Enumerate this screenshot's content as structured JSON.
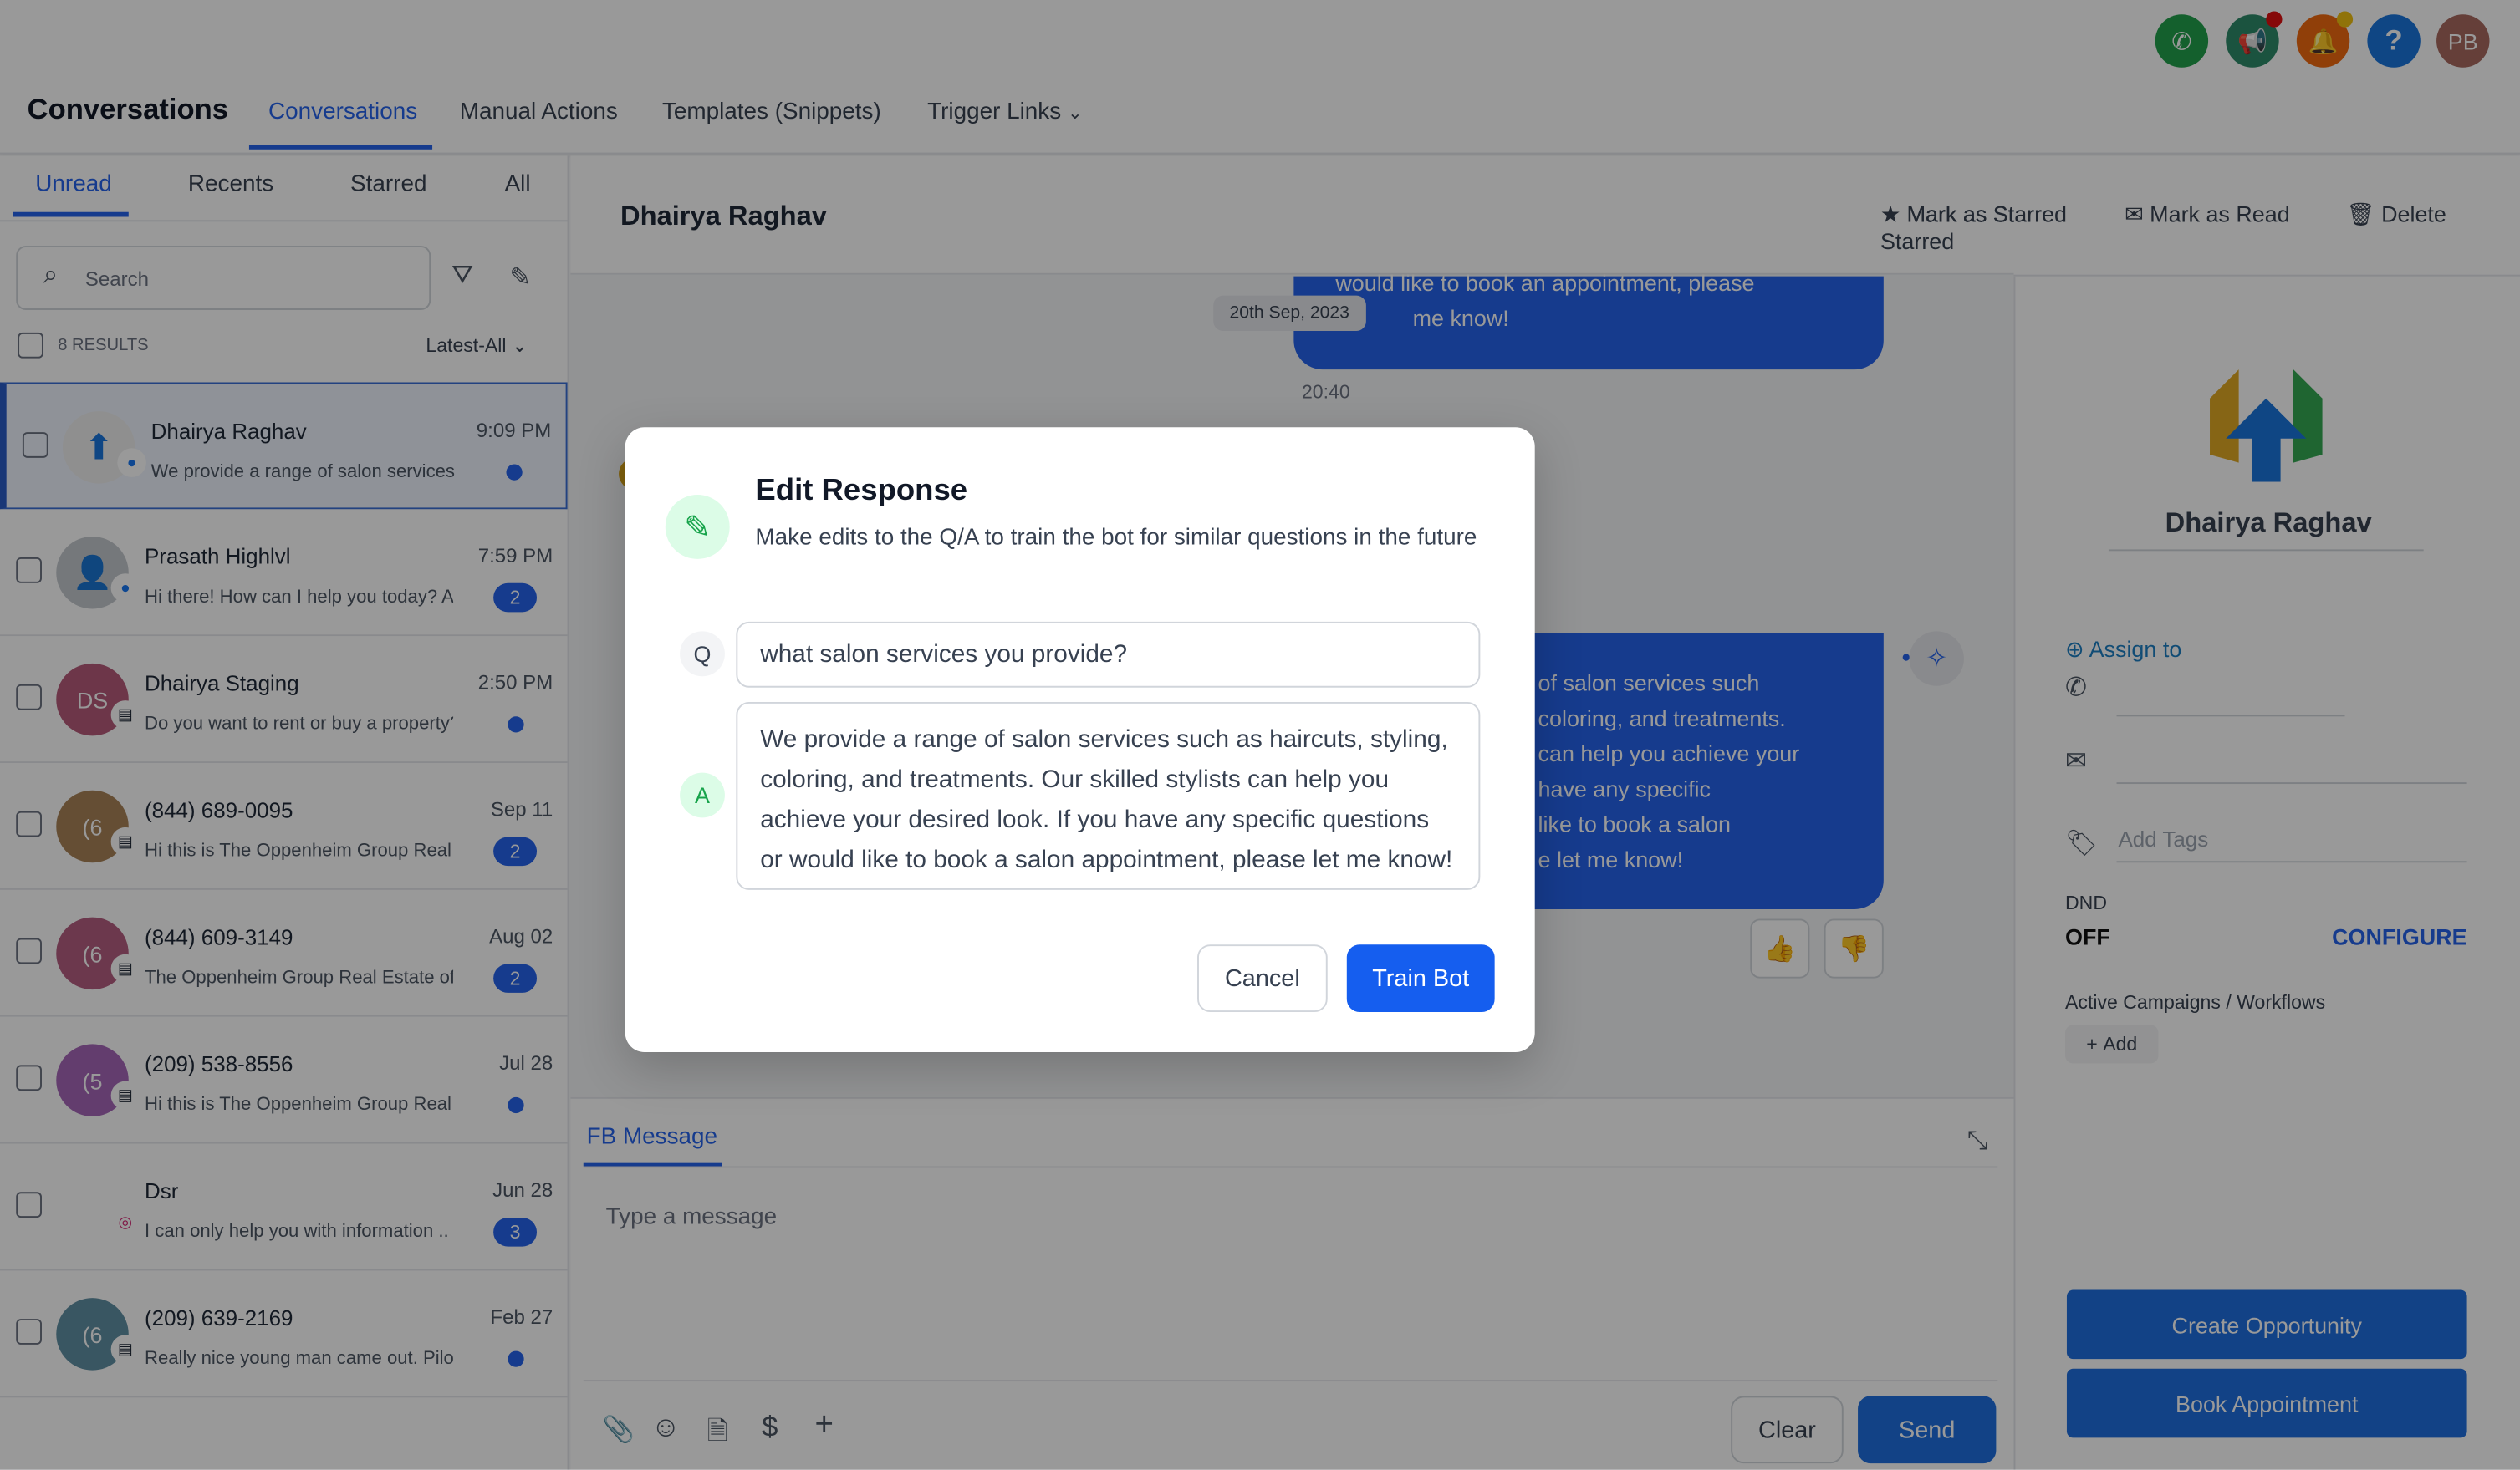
{
  "header": {
    "app_title": "Conversations",
    "nav_tabs": [
      {
        "label": "Conversations",
        "active": true
      },
      {
        "label": "Manual Actions"
      },
      {
        "label": "Templates (Snippets)"
      },
      {
        "label": "Trigger Links"
      }
    ],
    "icons": [
      {
        "name": "phone-icon",
        "color": "#22a04b"
      },
      {
        "name": "megaphone-icon",
        "color": "#2e8a6a"
      },
      {
        "name": "bell-icon",
        "color": "#f06a10"
      },
      {
        "name": "help-icon",
        "color": "#1a76dd"
      },
      {
        "name": "avatar",
        "color": "#a86a60"
      }
    ],
    "user_initials": "PB"
  },
  "sidebar": {
    "tabs": [
      "Unread",
      "Recents",
      "Starred",
      "All"
    ],
    "active_tab": "Unread",
    "search_placeholder": "Search",
    "results": "8 RESULTS",
    "sort": "Latest-All",
    "items": [
      {
        "name": "Dhairya Raghav",
        "time": "9:09 PM",
        "preview": "We provide a range of salon services",
        "unread": null,
        "channel": "messenger",
        "avatar": "logo",
        "selected": true
      },
      {
        "name": "Prasath Highlvl",
        "time": "7:59 PM",
        "preview": "Hi there! How can I help you today? A.",
        "unread": "2",
        "channel": "messenger",
        "avatar": "person"
      },
      {
        "name": "Dhairya Staging",
        "time": "2:50 PM",
        "preview": "Do you want to rent or buy a property?",
        "unread": null,
        "channel": "sms",
        "avatar": "DS",
        "color": "#b65b7a"
      },
      {
        "name": "(844) 689-0095",
        "time": "Sep 11",
        "preview": "Hi this is The Oppenheim Group Real E",
        "unread": "2",
        "channel": "sms",
        "avatar": "(6",
        "color": "#a88257"
      },
      {
        "name": "(844) 609-3149",
        "time": "Aug 02",
        "preview": "The Oppenheim Group Real Estate off",
        "unread": "2",
        "channel": "sms",
        "avatar": "(6",
        "color": "#b45e80"
      },
      {
        "name": "(209) 538-8556",
        "time": "Jul 28",
        "preview": "Hi this is The Oppenheim Group Real E",
        "unread": null,
        "channel": "sms",
        "avatar": "(5",
        "color": "#a566b8"
      },
      {
        "name": "Dsr",
        "time": "Jun 28",
        "preview": "I can only help you with information ..",
        "unread": "3",
        "channel": "instagram",
        "avatar": "image"
      },
      {
        "name": "(209) 639-2169",
        "time": "Feb 27",
        "preview": "Really nice young man came out. Pilot",
        "unread": null,
        "channel": "sms",
        "avatar": "(6",
        "color": "#5f8fa3"
      }
    ]
  },
  "conversation": {
    "contact_name": "Dhairya Raghav",
    "actions": [
      "Mark as Starred",
      "Mark as Read",
      "Delete"
    ],
    "date_chip": "20th Sep, 2023",
    "msg1_lines": [
      "would like to book an appointment, please",
      "me know!"
    ],
    "msg1_time": "20:40",
    "msg2_lines": [
      "of salon services such",
      "coloring, and treatments.",
      "can help you achieve your",
      "have any specific",
      "like to book a salon",
      "e let me know!"
    ],
    "composer": {
      "tab": "FB Message",
      "placeholder": "Type a message",
      "clear": "Clear",
      "send": "Send"
    }
  },
  "contact_panel": {
    "name": "Dhairya Raghav",
    "assign": "Assign to",
    "tags_placeholder": "Add Tags",
    "dnd_label": "DND",
    "dnd_value": "OFF",
    "configure": "CONFIGURE",
    "campaigns_label": "Active Campaigns / Workflows",
    "add": "Add",
    "create_opportunity": "Create Opportunity",
    "book_appointment": "Book Appointment"
  },
  "modal": {
    "title": "Edit Response",
    "subtitle": "Make edits to the Q/A to train the bot for similar questions in the future",
    "q_label": "Q",
    "a_label": "A",
    "question": "what salon services you provide?",
    "answer": "We provide a range of salon services such as haircuts, styling, coloring, and treatments. Our skilled stylists can help you achieve your desired look. If you have any specific questions or would like to book a salon appointment, please let me know!",
    "cancel": "Cancel",
    "train": "Train Bot",
    "accent": "#155eef"
  }
}
